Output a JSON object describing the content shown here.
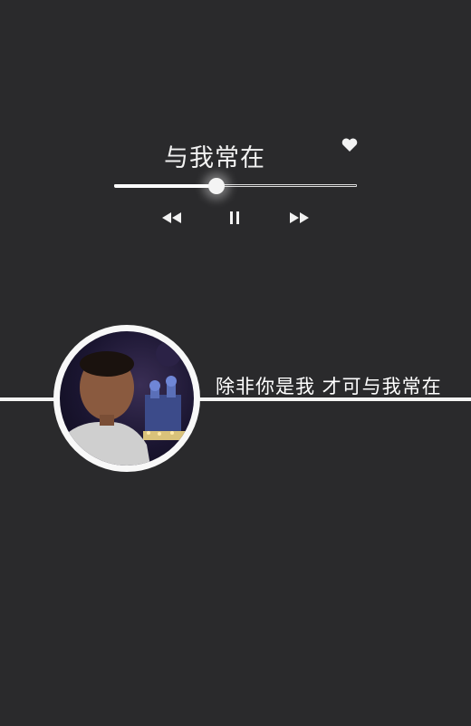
{
  "player": {
    "title": "与我常在",
    "favorite_icon": "heart-icon",
    "progress": 0.42,
    "controls": {
      "rewind_icon": "rewind-icon",
      "pause_icon": "pause-icon",
      "forward_icon": "fast-forward-icon"
    }
  },
  "lyric": {
    "text": "除非你是我 才可与我常在"
  },
  "colors": {
    "background": "#2a2a2c",
    "foreground": "#ffffff"
  }
}
